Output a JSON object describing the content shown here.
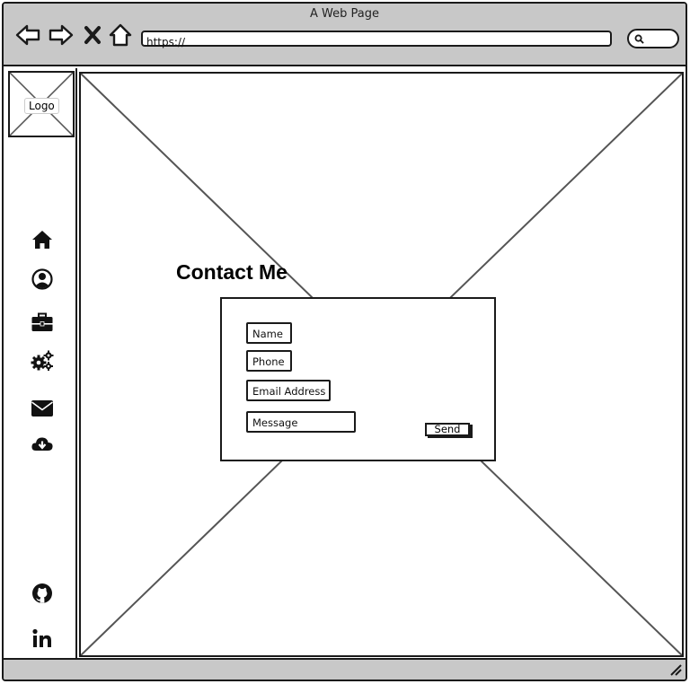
{
  "window": {
    "title": "A Web Page"
  },
  "toolbar": {
    "back_icon": "back-arrow-icon",
    "forward_icon": "forward-arrow-icon",
    "stop_icon": "close-icon",
    "home_icon": "home-outline-icon",
    "url": "https://",
    "search_icon": "search-icon"
  },
  "sidebar": {
    "logo_label": "Logo",
    "icons": [
      "home-icon",
      "user-icon",
      "briefcase-icon",
      "gears-icon",
      "mail-icon",
      "cloud-download-icon",
      "github-icon",
      "linkedin-icon"
    ]
  },
  "contact": {
    "heading": "Contact Me",
    "name_placeholder": "Name",
    "phone_placeholder": "Phone",
    "email_placeholder": "Email Address",
    "message_placeholder": "Message",
    "send_label": "Send"
  },
  "colors": {
    "chrome": "#c8c8c8",
    "stroke": "#1a1a1a",
    "background": "#ffffff"
  }
}
